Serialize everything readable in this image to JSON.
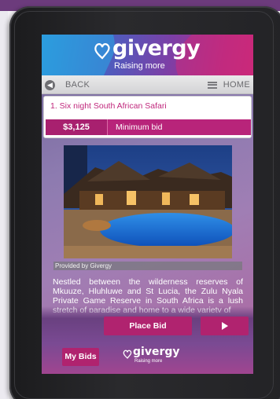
{
  "header": {
    "brand": "givergy",
    "tagline": "Raising more"
  },
  "nav": {
    "back_label": "BACK",
    "home_label": "HOME"
  },
  "item": {
    "title": "1. Six night South African Safari",
    "bid_amount": "$3,125",
    "bid_label": "Minimum bid"
  },
  "photo": {
    "caption": "Provided by Givergy"
  },
  "description": "Nestled between the wilderness reserves of Mkuuze, Hluhluwe and St Lucia, the Zulu Nyala Private Game Reserve in South Africa is a lush stretch of paradise and home to a wide variety of",
  "actions": {
    "place_bid": "Place Bid",
    "my_bids": "My Bids"
  },
  "footer": {
    "brand": "givergy",
    "tagline": "Raising more"
  },
  "colors": {
    "accent": "#b0236f",
    "title_pink": "#c0277c"
  },
  "icons": {
    "back": "back-arrow-icon",
    "home": "menu-lines-icon",
    "next": "play-icon",
    "logo": "heart-outline-icon"
  }
}
